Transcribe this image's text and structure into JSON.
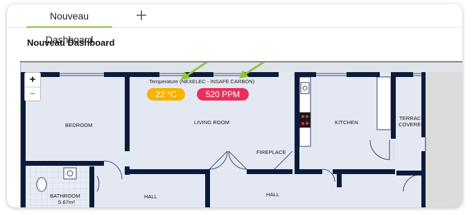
{
  "tabs": [
    {
      "label": "Nouveau Dashboard",
      "active": true
    }
  ],
  "dashboard": {
    "title": "Nouveau Dashboard"
  },
  "map": {
    "zoom_in": "+",
    "zoom_out": "−",
    "sensor_label": "Temperature (NEXELEC - INSAFE CARBON)",
    "rooms": {
      "bedroom": "BEDROOM",
      "living_room": "LIVING ROOM",
      "kitchen": "KITCHEN",
      "terrace_1": "TERRACE",
      "terrace_2": "COVERED",
      "fireplace": "FIREPLACE",
      "hall_1": "HALL",
      "hall_2": "HALL",
      "bathroom": "BATHROOM",
      "bathroom_area": "5.67m²"
    }
  },
  "sensors": {
    "temperature": {
      "value": "22 °C",
      "color": "#f5b400"
    },
    "co2": {
      "value": "520 PPM",
      "color": "#e8315a"
    }
  },
  "colors": {
    "accent": "#8bc34a",
    "wall": "#0c1a3b",
    "floor": "#e3e8f2",
    "arrow": "#8cc63f"
  }
}
